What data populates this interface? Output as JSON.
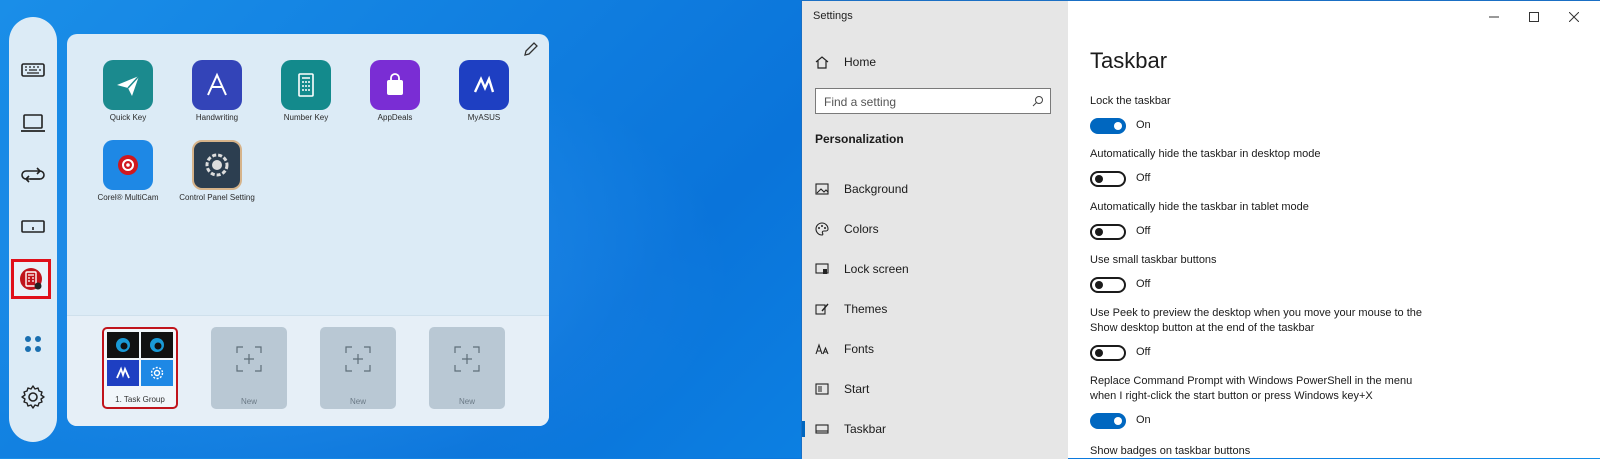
{
  "launcher": {
    "apps": [
      {
        "label": "Quick Key",
        "color": "#1b8a8e"
      },
      {
        "label": "Handwriting",
        "color": "#3344b8"
      },
      {
        "label": "Number Key",
        "color": "#138a8c"
      },
      {
        "label": "AppDeals",
        "color": "#7a2dd4"
      },
      {
        "label": "MyASUS",
        "color": "#1e3fc2"
      },
      {
        "label": "Corel® MultiCam",
        "color": "#1565c0"
      },
      {
        "label": "Control Panel Setting",
        "color": "#2c3e50"
      }
    ],
    "groups": [
      {
        "label": "1. Task Group"
      },
      {
        "label": "New"
      },
      {
        "label": "New"
      },
      {
        "label": "New"
      }
    ],
    "rail_icons": [
      "keyboard-icon",
      "laptop-icon",
      "switch-icon",
      "touchpad-icon",
      "calculator-icon",
      "apps-grid-icon",
      "gear-icon"
    ]
  },
  "settings": {
    "window_title": "Settings",
    "home_label": "Home",
    "search_placeholder": "Find a setting",
    "section": "Personalization",
    "nav": [
      {
        "label": "Background"
      },
      {
        "label": "Colors"
      },
      {
        "label": "Lock screen"
      },
      {
        "label": "Themes"
      },
      {
        "label": "Fonts"
      },
      {
        "label": "Start"
      },
      {
        "label": "Taskbar"
      }
    ],
    "page_title": "Taskbar",
    "options": [
      {
        "label": "Lock the taskbar",
        "state": "On"
      },
      {
        "label": "Automatically hide the taskbar in desktop mode",
        "state": "Off"
      },
      {
        "label": "Automatically hide the taskbar in tablet mode",
        "state": "Off"
      },
      {
        "label": "Use small taskbar buttons",
        "state": "Off"
      },
      {
        "label": "Use Peek to preview the desktop when you move your mouse to the Show desktop button at the end of the taskbar",
        "state": "Off"
      },
      {
        "label": "Replace Command Prompt with Windows PowerShell in the menu when I right-click the start button or press Windows key+X",
        "state": "On"
      },
      {
        "label": "Show badges on taskbar buttons"
      }
    ],
    "accent_color": "#0067c0"
  }
}
